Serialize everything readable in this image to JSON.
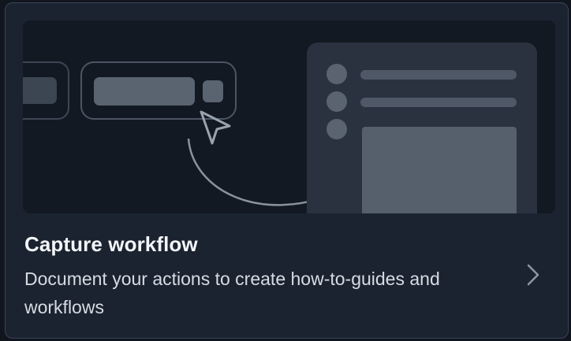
{
  "card": {
    "title": "Capture workflow",
    "description": "Document your actions to create how-to-guides and workflows",
    "action_icon": "chevron-right-icon"
  },
  "illustration": {
    "elements": [
      "button-pill",
      "cursor-arrow-icon",
      "curved-arrow",
      "document-panel"
    ]
  },
  "colors": {
    "card_background": "#1b2330",
    "card_border": "#3a4555",
    "illustration_background": "#121922",
    "shape_fill": "#5a6370",
    "panel_fill": "#2a3240",
    "title_text": "#f3f5f8",
    "description_text": "#d7dce3"
  }
}
